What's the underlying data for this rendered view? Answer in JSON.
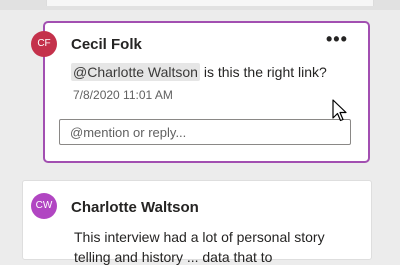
{
  "comments": [
    {
      "initials": "CF",
      "author": "Cecil Folk",
      "mention": "@Charlotte Waltson",
      "text": " is this the right link?",
      "timestamp": "7/8/2020 11:01 AM",
      "more_label": "•••",
      "avatar_color": "#c4314b"
    },
    {
      "initials": "CW",
      "author": "Charlotte Waltson",
      "text": "This interview had a lot of personal story",
      "text_line2": "telling and history ... data that to",
      "avatar_color": "#b146c2"
    }
  ],
  "reply": {
    "placeholder": "@mention or reply...",
    "value": ""
  },
  "colors": {
    "active_border": "#a24fb1",
    "background": "#ececec"
  }
}
